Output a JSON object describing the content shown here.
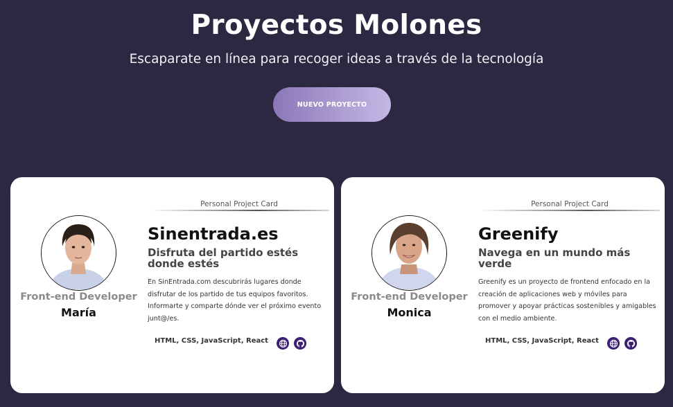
{
  "header": {
    "title": "Proyectos Molones",
    "subtitle": "Escaparate en línea para recoger ideas a través de la tecnología",
    "new_project_label": "NUEVO PROYECTO"
  },
  "cards": [
    {
      "label": "Personal Project Card",
      "author_role": "Front-end Developer",
      "author_name": "María",
      "project_name": "Sinentrada.es",
      "slogan": "Disfruta del partido estés donde estés",
      "description": "En SinEntrada.com descubrirás lugares donde disfrutar de los partido de tus equipos favoritos. Informarte y comparte dónde ver el próximo evento junt@/es.",
      "technologies": "HTML, CSS, JavaScript, React",
      "icons": [
        "globe-icon",
        "github-icon"
      ]
    },
    {
      "label": "Personal Project Card",
      "author_role": "Front-end Developer",
      "author_name": "Monica",
      "project_name": "Greenify",
      "slogan": "Navega en un mundo más verde",
      "description": "Greenify es un proyecto de frontend enfocado en la creación de aplicaciones web y móviles para promover y apoyar prácticas sostenibles y amigables con el medio ambiente.",
      "technologies": "HTML, CSS, JavaScript, React",
      "icons": [
        "globe-icon",
        "github-icon"
      ]
    }
  ],
  "colors": {
    "background": "#2d2841",
    "button_gradient_start": "#8b77b8",
    "button_gradient_end": "#c5b8e4",
    "card_background": "#ffffff",
    "icon_circle": "#3b1f73",
    "role_text": "#8a8a8a"
  }
}
